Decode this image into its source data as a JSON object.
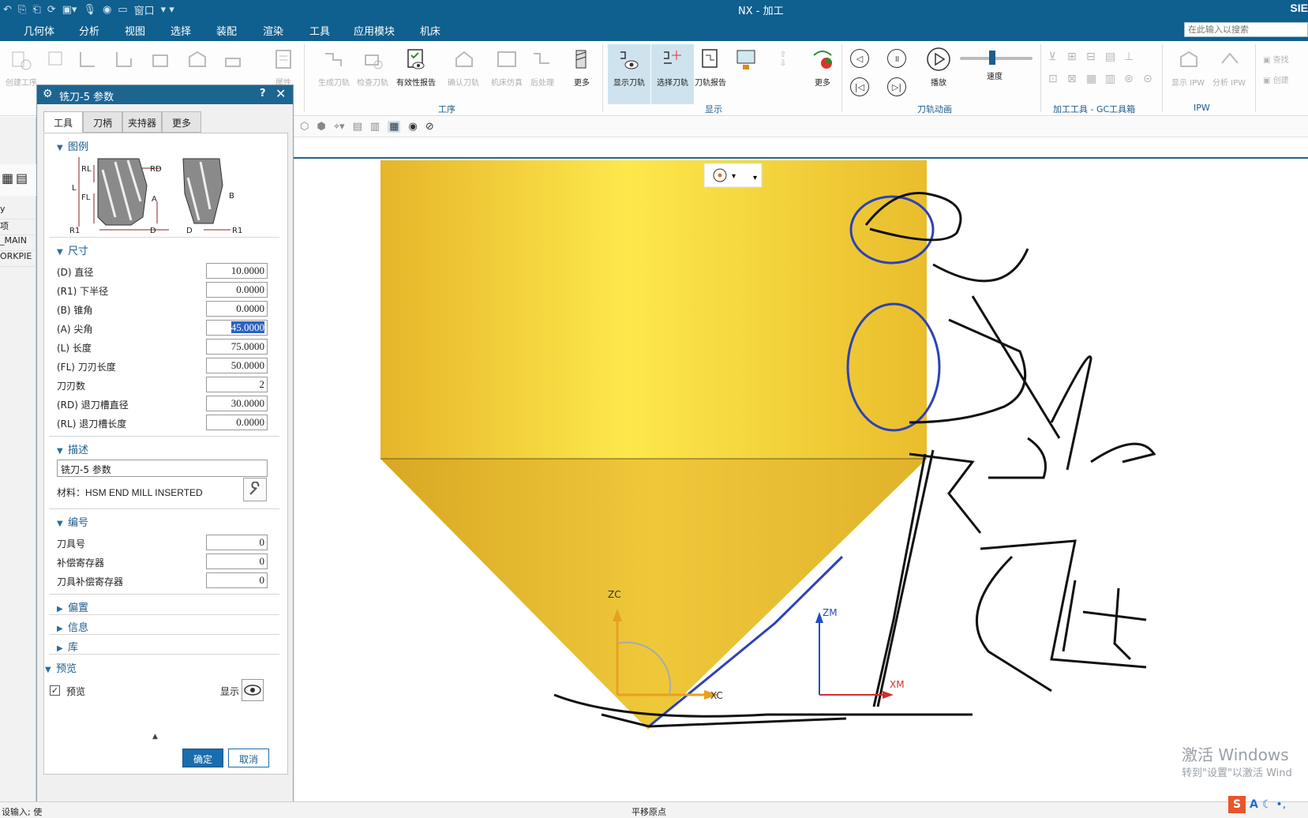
{
  "titlebar": {
    "window_menu": "窗口",
    "app_title": "NX - 加工",
    "brand": "SIE"
  },
  "menubar": {
    "items": [
      "几何体",
      "分析",
      "视图",
      "选择",
      "装配",
      "渲染",
      "工具",
      "应用模块",
      "机床"
    ],
    "search_placeholder": "在此输入以搜索"
  },
  "ribbon": {
    "left_buttons": [
      "创建工序",
      "",
      "",
      "",
      "",
      "",
      "",
      "",
      "属性"
    ],
    "ops_buttons": [
      "生成刀轨",
      "检查刀轨",
      "有效性报告",
      "确认刀轨",
      "机床仿真",
      "后处理",
      "更多"
    ],
    "ops_group": "工序",
    "display_buttons": [
      "显示刀轨",
      "选择刀轨",
      "刀轨报告",
      "更多"
    ],
    "display_group": "显示",
    "anim_buttons": [
      "播放",
      "速度"
    ],
    "anim_group": "刀轨动画",
    "gc_group": "加工工具 - GC工具箱",
    "ipw_buttons": [
      "显示 IPW",
      "分析 IPW"
    ],
    "ipw_group": "IPW",
    "right_buttons": [
      "查找",
      "创建"
    ]
  },
  "leftnav": {
    "rows": [
      "y",
      "项",
      "_MAIN",
      "ORKPIE"
    ]
  },
  "dialog": {
    "title": "铣刀-5 参数",
    "tabs": [
      "工具",
      "刀柄",
      "夹持器",
      "更多"
    ],
    "sections": {
      "legend": "图例",
      "size": "尺寸",
      "desc": "描述",
      "number": "编号",
      "offset": "偏置",
      "info": "信息",
      "library": "库",
      "preview": "预览"
    },
    "legend_labels": [
      "RL",
      "RD",
      "L",
      "FL",
      "A",
      "R1",
      "D",
      "B",
      "D",
      "R1"
    ],
    "params": [
      {
        "label": "(D) 直径",
        "value": "10.0000"
      },
      {
        "label": "(R1) 下半径",
        "value": "0.0000"
      },
      {
        "label": "(B) 锥角",
        "value": "0.0000"
      },
      {
        "label": "(A) 尖角",
        "value": "45.0000"
      },
      {
        "label": "(L) 长度",
        "value": "75.0000"
      },
      {
        "label": "(FL) 刀刃长度",
        "value": "50.0000"
      },
      {
        "label": "刀刃数",
        "value": "2"
      },
      {
        "label": "(RD) 退刀槽直径",
        "value": "30.0000"
      },
      {
        "label": "(RL) 退刀槽长度",
        "value": "0.0000"
      }
    ],
    "description_value": "铣刀-5 参数",
    "material": "材料：HSM END MILL INSERTED",
    "numbers": [
      {
        "label": "刀具号",
        "value": "0"
      },
      {
        "label": "补偿寄存器",
        "value": "0"
      },
      {
        "label": "刀具补偿寄存器",
        "value": "0"
      }
    ],
    "preview_label": "预览",
    "show_label": "显示",
    "ok": "确定",
    "cancel": "取消"
  },
  "viewport": {
    "axis_labels": {
      "zc": "ZC",
      "xc": "XC",
      "zm": "ZM",
      "xm": "XM"
    }
  },
  "status": {
    "left": "设输入; 使",
    "mid": "平移原点"
  },
  "watermark": {
    "line1": "激活 Windows",
    "line2": "转到\"设置\"以激活 Wind"
  },
  "tray": {
    "logo": "S",
    "lang": "A"
  },
  "colors": {
    "brand_blue": "#0f5f8f",
    "tool_body": "#f3cd3a",
    "ok_button": "#1a6dac"
  }
}
